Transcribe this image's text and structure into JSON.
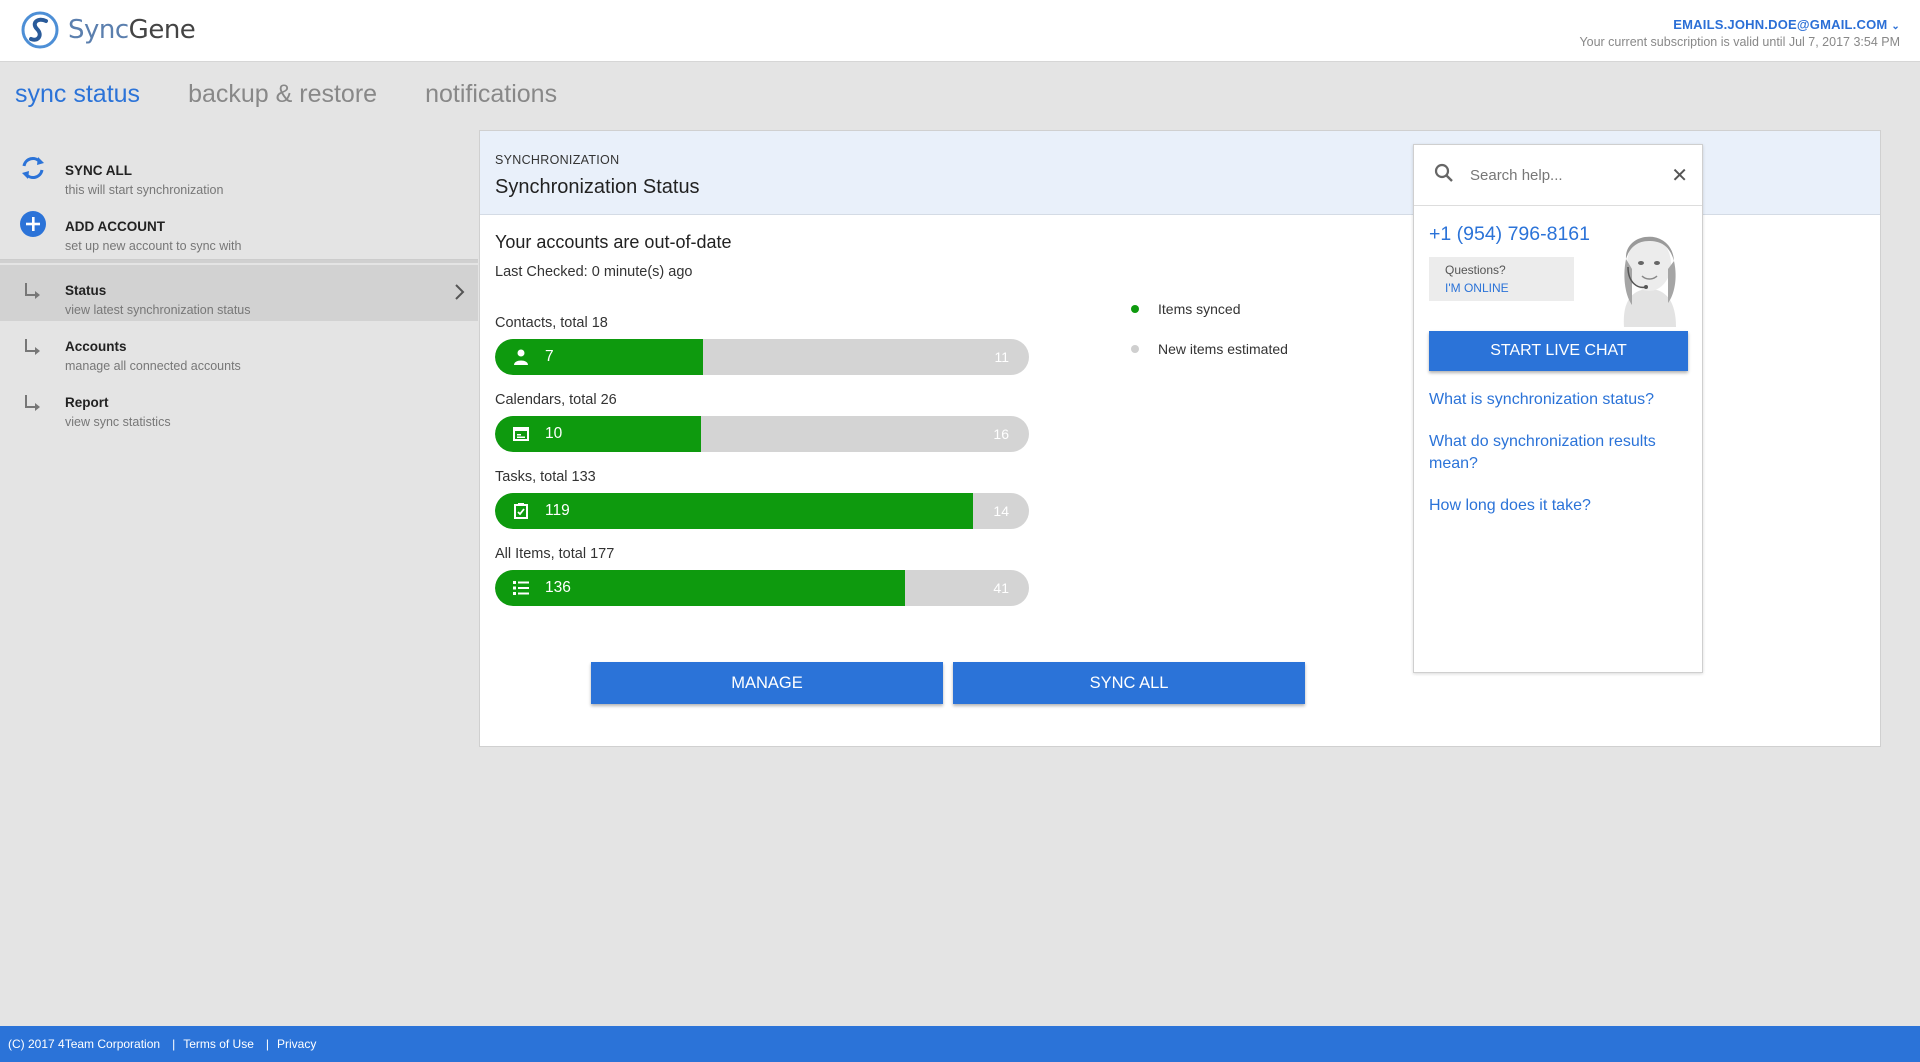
{
  "header": {
    "brand_sync": "Sync",
    "brand_gene": "Gene",
    "account_email": "EMAILS.JOHN.DOE@GMAIL.COM",
    "subscription": "Your current subscription is valid until Jul 7, 2017 3:54 PM"
  },
  "topnav": {
    "tabs": [
      {
        "label": "sync status",
        "active": true
      },
      {
        "label": "backup & restore",
        "active": false
      },
      {
        "label": "notifications",
        "active": false
      }
    ]
  },
  "sidebar": {
    "actions": [
      {
        "title": "SYNC ALL",
        "sub": "this will start synchronization",
        "icon": "sync-icon"
      },
      {
        "title": "ADD ACCOUNT",
        "sub": "set up new account to sync with",
        "icon": "add-circle-icon"
      }
    ],
    "items": [
      {
        "title": "Status",
        "sub": "view latest synchronization status",
        "active": true
      },
      {
        "title": "Accounts",
        "sub": "manage all connected accounts",
        "active": false
      },
      {
        "title": "Report",
        "sub": "view sync statistics",
        "active": false
      }
    ]
  },
  "panel": {
    "kicker": "SYNCHRONIZATION",
    "title": "Synchronization Status",
    "status": "Your accounts are out-of-date",
    "last_checked": "Last Checked: 0 minute(s) ago",
    "bars": [
      {
        "label": "Contacts, total 18",
        "synced": "7",
        "remaining": "11",
        "fraction": 0.389,
        "icon": "person-icon"
      },
      {
        "label": "Calendars, total 26",
        "synced": "10",
        "remaining": "16",
        "fraction": 0.385,
        "icon": "calendar-icon"
      },
      {
        "label": "Tasks, total 133",
        "synced": "119",
        "remaining": "14",
        "fraction": 0.895,
        "icon": "task-icon"
      },
      {
        "label": "All Items, total 177",
        "synced": "136",
        "remaining": "41",
        "fraction": 0.768,
        "icon": "list-icon"
      }
    ],
    "legend": [
      {
        "label": "Items synced",
        "color": "#0e9a0e"
      },
      {
        "label": "New items estimated",
        "color": "#cfcfcf"
      }
    ],
    "manage_label": "MANAGE",
    "sync_all_label": "SYNC ALL"
  },
  "help": {
    "search_placeholder": "Search help...",
    "phone": "+1 (954) 796-8161",
    "questions": "Questions?",
    "online": "I'M ONLINE",
    "chat_label": "START LIVE CHAT",
    "links": [
      "What is synchronization status?",
      "What do synchronization results mean?",
      "How long does it take?"
    ]
  },
  "footer": {
    "copyright": "(C) 2017  4Team Corporation",
    "terms": "Terms of Use",
    "privacy": "Privacy"
  },
  "colors": {
    "accent": "#2b73d8",
    "synced": "#0e9a0e",
    "remaining": "#d4d4d4"
  }
}
